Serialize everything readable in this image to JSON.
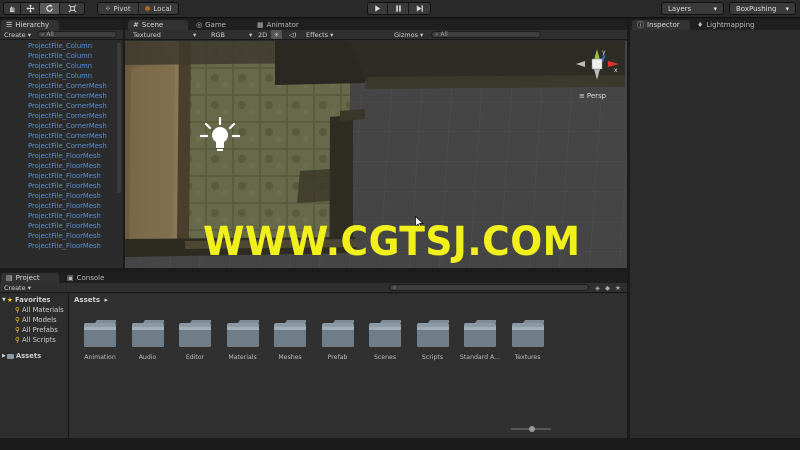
{
  "toolbar": {
    "pivot_label": "Pivot",
    "local_label": "Local",
    "layers_label": "Layers",
    "layout_label": "BoxPushing",
    "dropdown_arrow": "▾"
  },
  "hierarchy": {
    "tab_label": "Hierarchy",
    "create_label": "Create",
    "search_placeholder": "All",
    "items": [
      "ProjectFile_Column",
      "ProjectFile_Column",
      "ProjectFile_Column",
      "ProjectFile_Column",
      "ProjectFile_CornerMesh",
      "ProjectFile_CornerMesh",
      "ProjectFile_CornerMesh",
      "ProjectFile_CornerMesh",
      "ProjectFile_CornerMesh",
      "ProjectFile_CornerMesh",
      "ProjectFile_CornerMesh",
      "ProjectFile_FloorMesh",
      "ProjectFile_FloorMesh",
      "ProjectFile_FloorMesh",
      "ProjectFile_FloorMesh",
      "ProjectFile_FloorMesh",
      "ProjectFile_FloorMesh",
      "ProjectFile_FloorMesh",
      "ProjectFile_FloorMesh",
      "ProjectFile_FloorMesh",
      "ProjectFile_FloorMesh"
    ]
  },
  "scene": {
    "tabs": [
      "Scene",
      "Game",
      "Animator"
    ],
    "textured_label": "Textured",
    "rgb_label": "RGB",
    "twod_label": "2D",
    "effects_label": "Effects",
    "gizmos_label": "Gizmos",
    "search_placeholder": "All",
    "persp_label": "Persp",
    "gizmo_x": "x",
    "gizmo_y": "y",
    "watermark": "WWW.CGTSJ.COM"
  },
  "inspector": {
    "tab_label": "Inspector",
    "lightmapping_label": "Lightmapping"
  },
  "project": {
    "tab_label": "Project",
    "console_label": "Console",
    "create_label": "Create",
    "favorites_label": "Favorites",
    "favorites": [
      "All Materials",
      "All Models",
      "All Prefabs",
      "All Scripts"
    ],
    "assets_tree_label": "Assets",
    "breadcrumb": "Assets",
    "folders": [
      "Animation",
      "Audio",
      "Editor",
      "Materials",
      "Meshes",
      "Prefab",
      "Scenes",
      "Scripts",
      "Standard A...",
      "Textures"
    ]
  }
}
